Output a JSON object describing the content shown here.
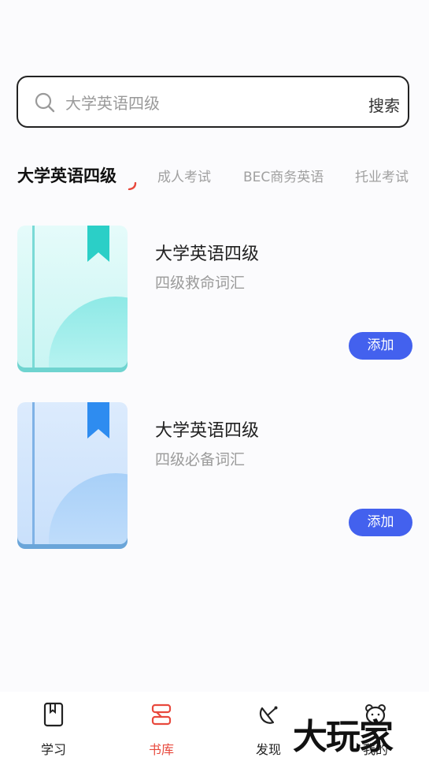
{
  "search": {
    "placeholder": "大学英语四级",
    "button_label": "搜索"
  },
  "tabs": [
    {
      "label": "大学英语四级",
      "active": true
    },
    {
      "label": "成人考试"
    },
    {
      "label": "BEC商务英语"
    },
    {
      "label": "托业考试"
    }
  ],
  "books": [
    {
      "title": "大学英语四级",
      "subtitle": "四级救命词汇",
      "add_label": "添加",
      "theme": "teal",
      "accent": "#2bcfc7"
    },
    {
      "title": "大学英语四级",
      "subtitle": "四级必备词汇",
      "add_label": "添加",
      "theme": "blue",
      "accent": "#2e8cf0"
    }
  ],
  "nav": [
    {
      "label": "学习",
      "icon": "book-icon"
    },
    {
      "label": "书库",
      "icon": "bookshelf-icon",
      "active": true
    },
    {
      "label": "发现",
      "icon": "satellite-dish-icon"
    },
    {
      "label": "我的",
      "icon": "bear-face-icon"
    }
  ],
  "watermark": "大玩家",
  "colors": {
    "accent": "#4361ee",
    "nav_active": "#e8493d"
  }
}
